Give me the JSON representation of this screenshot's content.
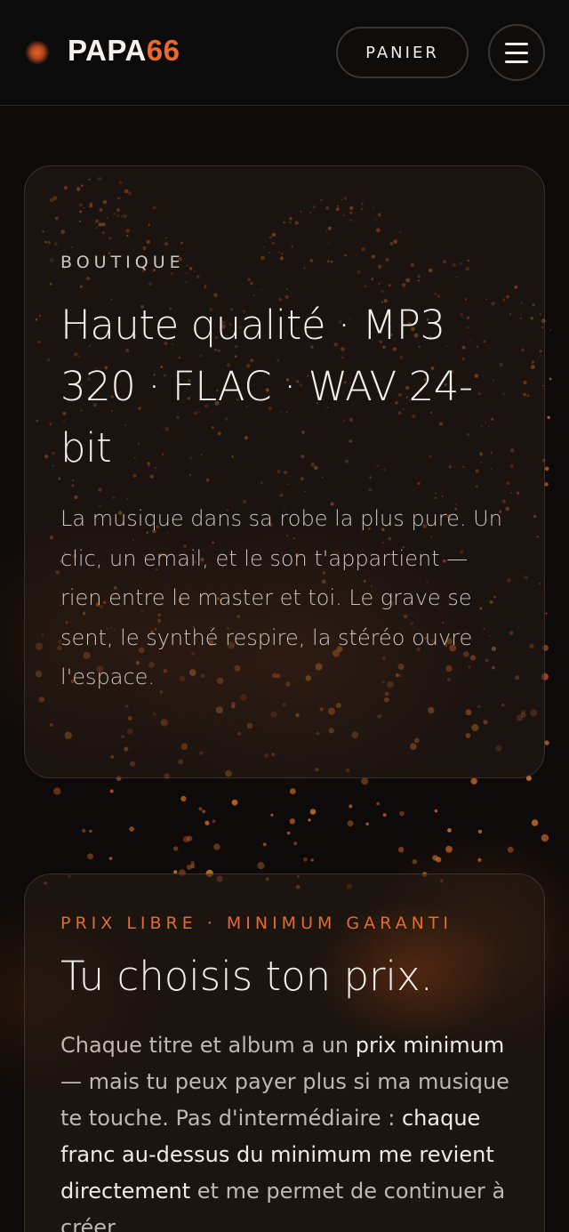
{
  "header": {
    "brand_main": "PAPA",
    "brand_accent": "66",
    "cart_label": "PANIER"
  },
  "shop": {
    "eyebrow": "BOUTIQUE",
    "title": "Haute qualité · MP3 320 · FLAC · WAV 24-bit",
    "body": "La musique dans sa robe la plus pure. Un clic, un email, et le son t'appartient — rien entre le master et toi. Le grave se sent, le synthé respire, la stéréo ouvre l'espace."
  },
  "pricing": {
    "eyebrow": "PRIX LIBRE · MINIMUM GARANTI",
    "title": "Tu choisis ton prix.",
    "body_1": "Chaque titre et album a un ",
    "body_2": "prix minimum",
    "body_3": " — mais tu peux payer plus si ma musique te touche. Pas d'intermédiaire : ",
    "body_4": "chaque franc au-dessus du minimum me revient directement",
    "body_5": " et me permet de continuer à créer."
  },
  "colors": {
    "accent": "#ea6a2b",
    "background": "#0b0908",
    "text": "#ece7e2"
  },
  "icons": {
    "logo": "orange-dot-icon",
    "menu": "hamburger-icon"
  }
}
